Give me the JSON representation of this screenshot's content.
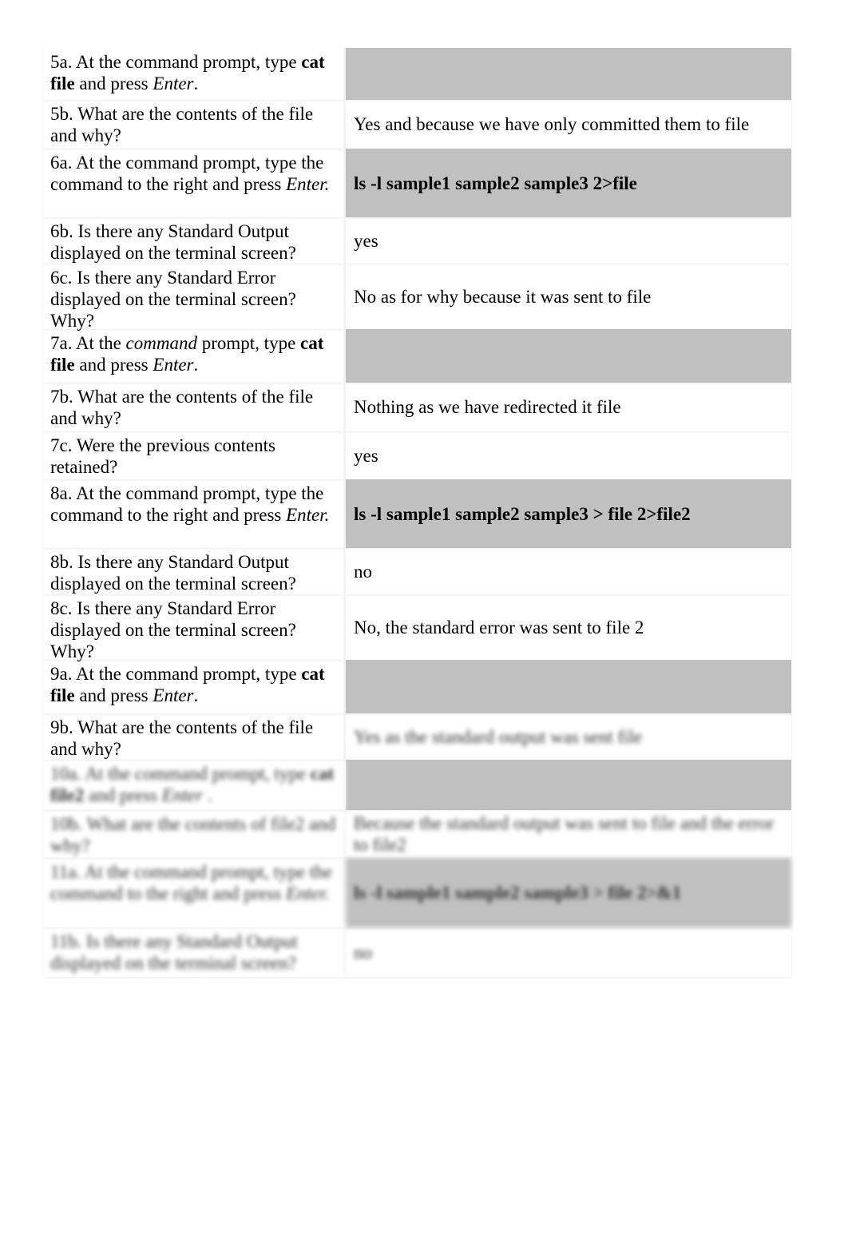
{
  "rows": [
    {
      "q": [
        {
          "t": "5a. At the command prompt, type "
        },
        {
          "t": "cat file",
          "b": true
        },
        {
          "t": " and press "
        },
        {
          "t": "Enter",
          "i": true
        },
        {
          "t": "."
        }
      ],
      "a": "",
      "gray": true
    },
    {
      "q": [
        {
          "t": "5b. What are the contents of the file and why?"
        }
      ],
      "a": "Yes and because we have only committed them to file"
    },
    {
      "q": [
        {
          "t": "6a. At the command prompt, type the command to the right and press "
        },
        {
          "t": "Enter.",
          "i": true
        }
      ],
      "a": "ls -l sample1 sample2 sample3 2>file",
      "gray": true,
      "bold": true
    },
    {
      "q": [
        {
          "t": "6b. Is there any Standard Output displayed on the terminal screen?"
        }
      ],
      "a": "yes"
    },
    {
      "q": [
        {
          "t": "6c. Is there any Standard Error displayed on the terminal screen? Why?"
        }
      ],
      "a": "No as for why because it was sent to file"
    },
    {
      "q": [
        {
          "t": "7a. At the "
        },
        {
          "t": "command",
          "i": true
        },
        {
          "t": " prompt, type "
        },
        {
          "t": "cat file",
          "b": true
        },
        {
          "t": " and press "
        },
        {
          "t": "Enter",
          "i": true
        },
        {
          "t": "."
        }
      ],
      "a": "",
      "gray": true
    },
    {
      "q": [
        {
          "t": "7b. What are the contents of the file and why?"
        }
      ],
      "a": "Nothing as we have redirected it file"
    },
    {
      "q": [
        {
          "t": "7c. Were the previous contents retained?"
        }
      ],
      "a": "yes"
    },
    {
      "q": [
        {
          "t": "8a. At the command prompt, type the command to the right and press "
        },
        {
          "t": "Enter.",
          "i": true
        }
      ],
      "a": "ls -l sample1 sample2 sample3 > file 2>file2",
      "gray": true,
      "bold": true
    },
    {
      "q": [
        {
          "t": "8b. Is there any Standard Output displayed on the terminal screen?"
        }
      ],
      "a": "no"
    },
    {
      "q": [
        {
          "t": "8c. Is there any Standard Error displayed on the terminal screen? Why?"
        }
      ],
      "a": "No, the standard error was sent to file 2"
    },
    {
      "q": [
        {
          "t": "9a. At the command prompt, type "
        },
        {
          "t": "cat file",
          "b": true
        },
        {
          "t": " and press "
        },
        {
          "t": "Enter",
          "i": true
        },
        {
          "t": "."
        }
      ],
      "a": "",
      "gray": true
    },
    {
      "q": [
        {
          "t": "9b. What are the contents of the file and why?"
        }
      ],
      "a": "Yes as the standard output was sent file",
      "blurA": true
    },
    {
      "q": [
        {
          "t": "10a. At the command prompt, type "
        },
        {
          "t": "cat file2",
          "b": true
        },
        {
          "t": " and press "
        },
        {
          "t": "Enter",
          "i": true
        },
        {
          "t": " ."
        }
      ],
      "a": "",
      "gray": true,
      "blurQ": true
    },
    {
      "q": [
        {
          "t": "10b. What are the contents of file2 and why?"
        }
      ],
      "a": "Because the standard output was sent to file and the error to file2",
      "blurQ": true,
      "blurA": true
    },
    {
      "q": [
        {
          "t": "11a. At the command prompt, type the command to the right and press "
        },
        {
          "t": "Enter.",
          "i": true
        }
      ],
      "a": "ls -l sample1 sample2 sample3 > file 2>&1",
      "gray": true,
      "bold": true,
      "blurQ": true,
      "blurA": true
    },
    {
      "q": [
        {
          "t": "11b. Is there any Standard Output displayed on the terminal screen?"
        }
      ],
      "a": "no",
      "blurQ": true,
      "blurA": true
    }
  ],
  "colors": {
    "answer_shade": "#c0c0c0"
  }
}
